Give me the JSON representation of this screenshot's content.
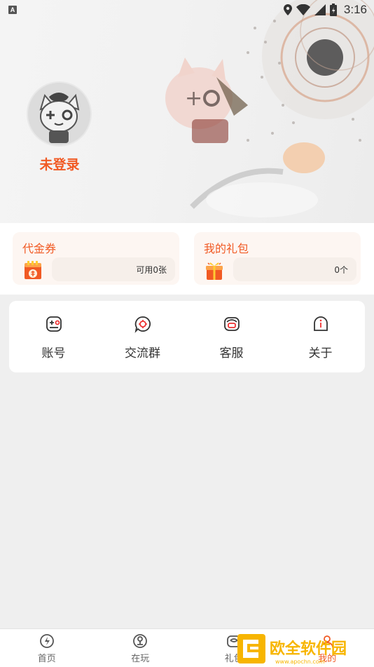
{
  "status_bar": {
    "time": "3:16",
    "notification_badge": "A"
  },
  "profile": {
    "login_status": "未登录"
  },
  "wallet": {
    "voucher": {
      "title": "代金券",
      "count_text": "可用0张"
    },
    "gift": {
      "title": "我的礼包",
      "count_text": "0个"
    }
  },
  "menu": {
    "account": "账号",
    "group": "交流群",
    "service": "客服",
    "about": "关于"
  },
  "bottom_nav": {
    "home": "首页",
    "playing": "在玩",
    "gift": "礼包",
    "mine": "我的"
  },
  "watermark": {
    "cn": "欧全软件园",
    "url": "www.apochn.com"
  },
  "colors": {
    "accent": "#f15a24",
    "background": "#efefef"
  }
}
